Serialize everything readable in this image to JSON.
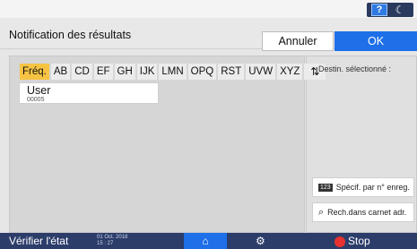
{
  "system": {
    "help_label": "?",
    "mode_icon": "crescent-moon"
  },
  "header": {
    "title": "Notification des résultats",
    "cancel_label": "Annuler",
    "ok_label": "OK"
  },
  "tabs": [
    "Fréq.",
    "AB",
    "CD",
    "EF",
    "GH",
    "IJK",
    "LMN",
    "OPQ",
    "RST",
    "UVW",
    "XYZ"
  ],
  "tab_active_index": 0,
  "list": {
    "items": [
      {
        "name": "User",
        "number": "00005"
      }
    ]
  },
  "right": {
    "destination_label": "Destin. sélectionné :",
    "specify_label": "Spécif. par n° enreg.",
    "specify_badge": "123",
    "search_label": "Rech.dans carnet adr."
  },
  "footer": {
    "check_status": "Vérifier l'état",
    "date_line1": "01 Oct. 2018",
    "date_line2": "15 : 27",
    "stop_label": "Stop"
  },
  "colors": {
    "accent_blue": "#1e6fe8",
    "tab_active": "#f6c343",
    "footer_bg": "#2c3d6a",
    "stop_red": "#e7322f"
  }
}
